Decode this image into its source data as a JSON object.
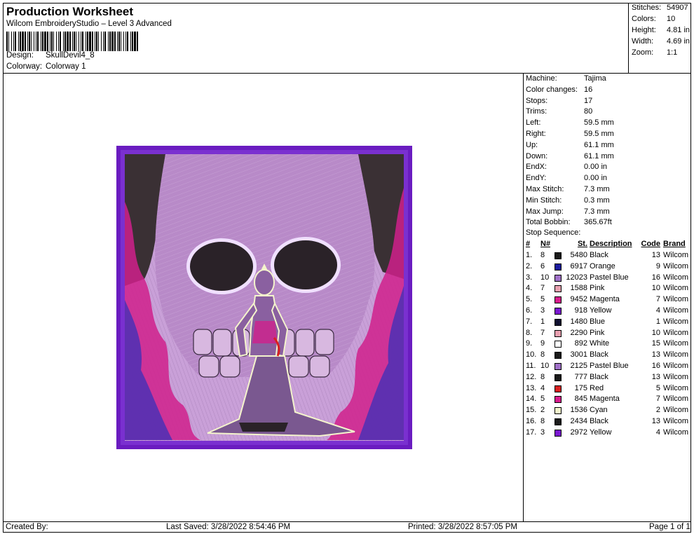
{
  "header": {
    "title": "Production Worksheet",
    "subtitle": "Wilcom EmbroideryStudio – Level 3 Advanced",
    "design_label": "Design:",
    "design_value": "SkullDevil4_8",
    "colorway_label": "Colorway:",
    "colorway_value": "Colorway 1"
  },
  "stats": [
    {
      "label": "Stitches:",
      "value": "54907"
    },
    {
      "label": "Colors:",
      "value": "10"
    },
    {
      "label": "Height:",
      "value": "4.81 in"
    },
    {
      "label": "Width:",
      "value": "4.69 in"
    },
    {
      "label": "Zoom:",
      "value": "1:1"
    }
  ],
  "machine_info": [
    {
      "label": "Machine:",
      "value": "Tajima"
    },
    {
      "label": "Color changes:",
      "value": "16"
    },
    {
      "label": "Stops:",
      "value": "17"
    },
    {
      "label": "Trims:",
      "value": "80"
    },
    {
      "label": "Left:",
      "value": "59.5 mm"
    },
    {
      "label": "Right:",
      "value": "59.5 mm"
    },
    {
      "label": "Up:",
      "value": "61.1 mm"
    },
    {
      "label": "Down:",
      "value": "61.1 mm"
    },
    {
      "label": "EndX:",
      "value": "0.00 in"
    },
    {
      "label": "EndY:",
      "value": "0.00 in"
    },
    {
      "label": "Max Stitch:",
      "value": "7.3 mm"
    },
    {
      "label": "Min Stitch:",
      "value": "0.3 mm"
    },
    {
      "label": "Max Jump:",
      "value": "7.3 mm"
    },
    {
      "label": "Total Bobbin:",
      "value": "365.67ft"
    }
  ],
  "stop_sequence": {
    "title": "Stop Sequence:",
    "headers": {
      "num": "#",
      "n": "N#",
      "st": "St.",
      "desc": "Description",
      "code": "Code",
      "brand": "Brand"
    },
    "rows": [
      {
        "num": "1.",
        "n": "8",
        "color": "#1a1a1a",
        "st": "5480",
        "desc": "Black",
        "code": "13",
        "brand": "Wilcom"
      },
      {
        "num": "2.",
        "n": "6",
        "color": "#1a1a9e",
        "st": "6917",
        "desc": "Orange",
        "code": "9",
        "brand": "Wilcom"
      },
      {
        "num": "3.",
        "n": "10",
        "color": "#a070c8",
        "st": "12023",
        "desc": "Pastel Blue",
        "code": "16",
        "brand": "Wilcom"
      },
      {
        "num": "4.",
        "n": "7",
        "color": "#e8a0b0",
        "st": "1588",
        "desc": "Pink",
        "code": "10",
        "brand": "Wilcom"
      },
      {
        "num": "5.",
        "n": "5",
        "color": "#d81c8c",
        "st": "9452",
        "desc": "Magenta",
        "code": "7",
        "brand": "Wilcom"
      },
      {
        "num": "6.",
        "n": "3",
        "color": "#7a16d0",
        "st": "918",
        "desc": "Yellow",
        "code": "4",
        "brand": "Wilcom"
      },
      {
        "num": "7.",
        "n": "1",
        "color": "#101030",
        "st": "1480",
        "desc": "Blue",
        "code": "1",
        "brand": "Wilcom"
      },
      {
        "num": "8.",
        "n": "7",
        "color": "#e8a0b0",
        "st": "2290",
        "desc": "Pink",
        "code": "10",
        "brand": "Wilcom"
      },
      {
        "num": "9.",
        "n": "9",
        "color": "#ffffff",
        "st": "892",
        "desc": "White",
        "code": "15",
        "brand": "Wilcom"
      },
      {
        "num": "10.",
        "n": "8",
        "color": "#1a1a1a",
        "st": "3001",
        "desc": "Black",
        "code": "13",
        "brand": "Wilcom"
      },
      {
        "num": "11.",
        "n": "10",
        "color": "#a070c8",
        "st": "2125",
        "desc": "Pastel Blue",
        "code": "16",
        "brand": "Wilcom"
      },
      {
        "num": "12.",
        "n": "8",
        "color": "#1a1a1a",
        "st": "777",
        "desc": "Black",
        "code": "13",
        "brand": "Wilcom"
      },
      {
        "num": "13.",
        "n": "4",
        "color": "#d82020",
        "st": "175",
        "desc": "Red",
        "code": "5",
        "brand": "Wilcom"
      },
      {
        "num": "14.",
        "n": "5",
        "color": "#d81c8c",
        "st": "845",
        "desc": "Magenta",
        "code": "7",
        "brand": "Wilcom"
      },
      {
        "num": "15.",
        "n": "2",
        "color": "#f4f4cc",
        "st": "1536",
        "desc": "Cyan",
        "code": "2",
        "brand": "Wilcom"
      },
      {
        "num": "16.",
        "n": "8",
        "color": "#1a1a1a",
        "st": "2434",
        "desc": "Black",
        "code": "13",
        "brand": "Wilcom"
      },
      {
        "num": "17.",
        "n": "3",
        "color": "#7a16d0",
        "st": "2972",
        "desc": "Yellow",
        "code": "4",
        "brand": "Wilcom"
      }
    ]
  },
  "footer": {
    "created": "Created By:",
    "saved": "Last Saved: 3/28/2022 8:54:46 PM",
    "printed": "Printed: 3/28/2022 8:57:05 PM",
    "page": "Page 1 of 1"
  },
  "colors": {
    "frame_purple": "#6a1cc0",
    "background_lilac": "#c9a0d8",
    "flame_magenta": "#d0208c",
    "flame_blue": "#3a30b8",
    "dark": "#2a2228"
  },
  "icons": [
    "barcode-icon",
    "embroidery-design-image"
  ]
}
